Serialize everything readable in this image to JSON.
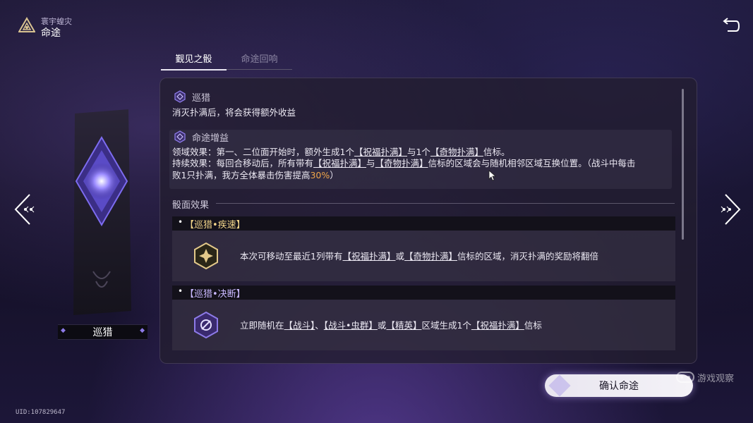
{
  "header": {
    "small_title": "寰宇蝗灾",
    "title": "命途",
    "logo_icon": "triangle-emblem-icon",
    "back_icon": "back-arrow-icon"
  },
  "tabs": [
    {
      "label": "觐见之骰",
      "active": true
    },
    {
      "label": "命途回响",
      "active": false
    }
  ],
  "path": {
    "name": "巡猎",
    "desc": "消灭扑满后，将会获得额外收益"
  },
  "buff": {
    "label": "命途增益",
    "line1_pre": "领域效果：第一、二位面开始时，额外生成1个",
    "line1_k1": "【祝福扑满】",
    "line1_mid": "与1个",
    "line1_k2": "【奇物扑满】",
    "line1_post": "信标。",
    "line2_pre": "持续效果：每回合移动后，所有带有",
    "line2_k1": "【祝福扑满】",
    "line2_mid": "与",
    "line2_k2": "【奇物扑满】",
    "line2_post": "信标的区域会与随机相邻区域互换位置。（战斗中每击",
    "line3_pre": "败1只扑满，我方全体暴击伤害提高",
    "line3_hl": "30%",
    "line3_post": "）"
  },
  "dice_faces": {
    "label": "骰面效果",
    "cards": [
      {
        "title": "【巡猎•疾速】",
        "text_pre": "本次可移动至最近1列带有",
        "k1": "【祝福扑满】",
        "mid": "或",
        "k2": "【奇物扑满】",
        "text_post": "信标的区域，消灭扑满的奖励将翻倍",
        "icon": "gold-star-hex-icon"
      },
      {
        "title": "【巡猎•决断】",
        "text_pre": "立即随机在",
        "k1": "【战斗】",
        "sep1": "、",
        "k2": "【战斗•虫群】",
        "mid": "或",
        "k3": "【精英】",
        "mid2": "区域生成1个",
        "k4": "【祝福扑满】",
        "text_post": "信标",
        "icon": "purple-target-hex-icon"
      }
    ]
  },
  "pillar_name": "巡猎",
  "confirm_label": "确认命途",
  "watermark": "游戏观察",
  "uid": "UID:107829647",
  "colors": {
    "accent_orange": "#f0a64a",
    "card_title_gold": "#f2d58a",
    "panel_bg": "#221e30"
  }
}
